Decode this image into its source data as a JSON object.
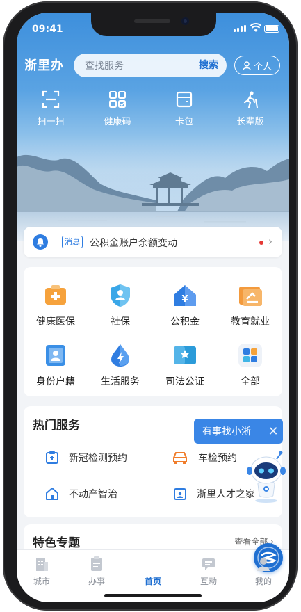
{
  "status_bar": {
    "time": "09:41"
  },
  "header": {
    "brand": "浙里办",
    "search_placeholder": "查找服务",
    "search_button": "搜索",
    "personal_button": "个人"
  },
  "quick_actions": [
    {
      "label": "扫一扫",
      "icon": "scan-icon"
    },
    {
      "label": "健康码",
      "icon": "health-code-icon"
    },
    {
      "label": "卡包",
      "icon": "card-wallet-icon"
    },
    {
      "label": "长辈版",
      "icon": "elder-mode-icon"
    }
  ],
  "message": {
    "tag": "消息",
    "text": "公积金账户余额变动",
    "unread": true
  },
  "services": [
    {
      "label": "健康医保",
      "icon": "medical-insurance-icon"
    },
    {
      "label": "社保",
      "icon": "social-security-icon"
    },
    {
      "label": "公积金",
      "icon": "housing-fund-icon"
    },
    {
      "label": "教育就业",
      "icon": "education-employment-icon"
    },
    {
      "label": "身份户籍",
      "icon": "identity-household-icon"
    },
    {
      "label": "生活服务",
      "icon": "life-service-icon"
    },
    {
      "label": "司法公证",
      "icon": "judicial-notary-icon"
    },
    {
      "label": "全部",
      "icon": "all-services-icon"
    }
  ],
  "hot_services": {
    "title": "热门服务",
    "items": [
      {
        "label": "新冠检测预约",
        "icon": "covid-test-icon"
      },
      {
        "label": "车检预约",
        "icon": "car-inspection-icon"
      },
      {
        "label": "不动产智治",
        "icon": "real-estate-icon"
      },
      {
        "label": "浙里人才之家",
        "icon": "talent-home-icon"
      }
    ]
  },
  "assistant": {
    "bubble_text": "有事找小浙",
    "close": "✕"
  },
  "featured": {
    "title": "特色专题",
    "more": "查看全部 ›"
  },
  "tabs": [
    {
      "label": "城市",
      "icon": "city-icon",
      "active": false
    },
    {
      "label": "办事",
      "icon": "affairs-icon",
      "active": false
    },
    {
      "label": "首页",
      "icon": "home-icon",
      "active": true
    },
    {
      "label": "互动",
      "icon": "interaction-icon",
      "active": false
    },
    {
      "label": "我的",
      "icon": "profile-icon",
      "active": false
    }
  ],
  "colors": {
    "primary": "#1f6fd1",
    "hero_top": "#3d8fdc",
    "background": "#f2f4f7",
    "badge_red": "#e53935"
  }
}
